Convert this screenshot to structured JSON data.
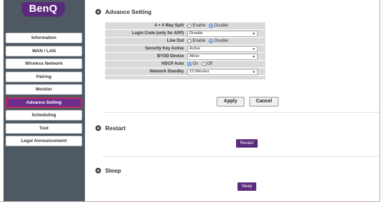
{
  "brand": {
    "logo_text": "BenQ"
  },
  "sidebar": {
    "items": [
      {
        "label": "Information"
      },
      {
        "label": "WAN / LAN"
      },
      {
        "label": "Wireless Network"
      },
      {
        "label": "Pairing"
      },
      {
        "label": "Monitor"
      },
      {
        "label": "Advance Setting",
        "active": true
      },
      {
        "label": "Scheduling"
      },
      {
        "label": "Tool"
      },
      {
        "label": "Legal Announcement"
      }
    ]
  },
  "advance": {
    "title": "Advance Setting",
    "rows": {
      "split": {
        "label": "4 + 4 Way Split",
        "opt_enable": "Enable",
        "opt_disable": "Disable",
        "selected": "Disable"
      },
      "login_code": {
        "label": "Login Code (only for APP)",
        "value": "Disable"
      },
      "line_out": {
        "label": "Line Out",
        "opt_enable": "Enable",
        "opt_disable": "Disable",
        "selected": "Disable"
      },
      "security_key": {
        "label": "Security Key Active",
        "value": "Active"
      },
      "byod": {
        "label": "BYOD Device",
        "value": "Allow"
      },
      "hdcp": {
        "label": "HDCP Auto",
        "opt_on": "On",
        "opt_off": "Off",
        "selected": "On"
      },
      "standby": {
        "label": "Network Standby",
        "value": "15 Minutes"
      }
    },
    "apply_label": "Apply",
    "cancel_label": "Cancel"
  },
  "restart": {
    "title": "Restart",
    "button_label": "Restart"
  },
  "sleep": {
    "title": "Sleep",
    "button_label": "Sleep"
  },
  "colors": {
    "brand_purple": "#5a2a7c",
    "sidebar_bg": "#4f5964",
    "active_border": "#c8285a"
  }
}
